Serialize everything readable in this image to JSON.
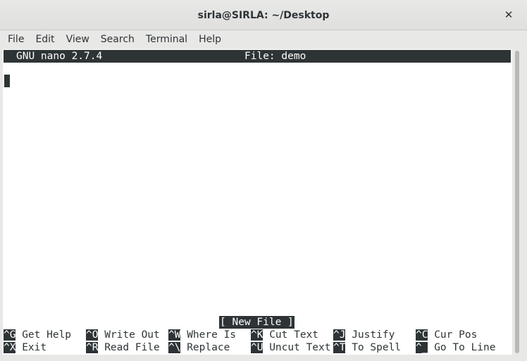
{
  "window": {
    "title": "sirla@SIRLA: ~/Desktop",
    "close_glyph": "✕"
  },
  "menubar": {
    "items": [
      "File",
      "Edit",
      "View",
      "Search",
      "Terminal",
      "Help"
    ]
  },
  "nano": {
    "version": "GNU nano 2.7.4",
    "file_label": "File: demo",
    "status": "[ New File ]",
    "shortcuts_row1": [
      {
        "key": "^G",
        "desc": " Get Help"
      },
      {
        "key": "^O",
        "desc": " Write Out"
      },
      {
        "key": "^W",
        "desc": " Where Is"
      },
      {
        "key": "^K",
        "desc": " Cut Text"
      },
      {
        "key": "^J",
        "desc": " Justify"
      },
      {
        "key": "^C",
        "desc": " Cur Pos"
      }
    ],
    "shortcuts_row2": [
      {
        "key": "^X",
        "desc": " Exit"
      },
      {
        "key": "^R",
        "desc": " Read File"
      },
      {
        "key": "^\\",
        "desc": " Replace"
      },
      {
        "key": "^U",
        "desc": " Uncut Text"
      },
      {
        "key": "^T",
        "desc": " To Spell"
      },
      {
        "key": "^_",
        "desc": " Go To Line"
      }
    ]
  }
}
